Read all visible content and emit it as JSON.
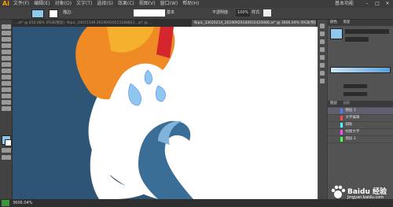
{
  "app": {
    "logo": "Ai",
    "workspace": "基本功能"
  },
  "menu": [
    "文件(F)",
    "编辑(E)",
    "对象(O)",
    "文字(T)",
    "选择(S)",
    "效果(C)",
    "视图(V)",
    "窗口(W)",
    "帮助(H)"
  ],
  "window_buttons": [
    "–",
    "□",
    "✕"
  ],
  "controlbar": {
    "stroke_label": "描边:",
    "stroke_val": "基本",
    "opacity_label": "不透明度:",
    "opacity_val": "100%",
    "style_label": "样式:"
  },
  "tabs": [
    {
      "label": "...ai* @ 450.08% (RGB/预览)",
      "active": false
    },
    {
      "label": "Nipic_10015149 20190920215246841...ai* @ ...",
      "active": false
    },
    {
      "label": "Nipic_33020214_20190920184931420086.ai* @ 3606.04% (RGB/预览)",
      "active": true
    }
  ],
  "panel": {
    "header1": "颜色",
    "header2": "渐变",
    "layers_tab1": "图层",
    "layers_tab2": "画板",
    "layers": [
      {
        "name": "图层 1",
        "color": "#4a7dff"
      },
      {
        "name": "文字编辑",
        "color": "#ff4a4a"
      },
      {
        "name": "辅助",
        "color": "#4affff"
      },
      {
        "name": "绘图文字",
        "color": "#ff4aff"
      },
      {
        "name": "图层 2",
        "color": "#4aff4a"
      }
    ]
  },
  "status": {
    "zoom": "3606.04%"
  },
  "watermark": {
    "text": "Baidu 经验",
    "url": "jingyan.baidu.com"
  }
}
